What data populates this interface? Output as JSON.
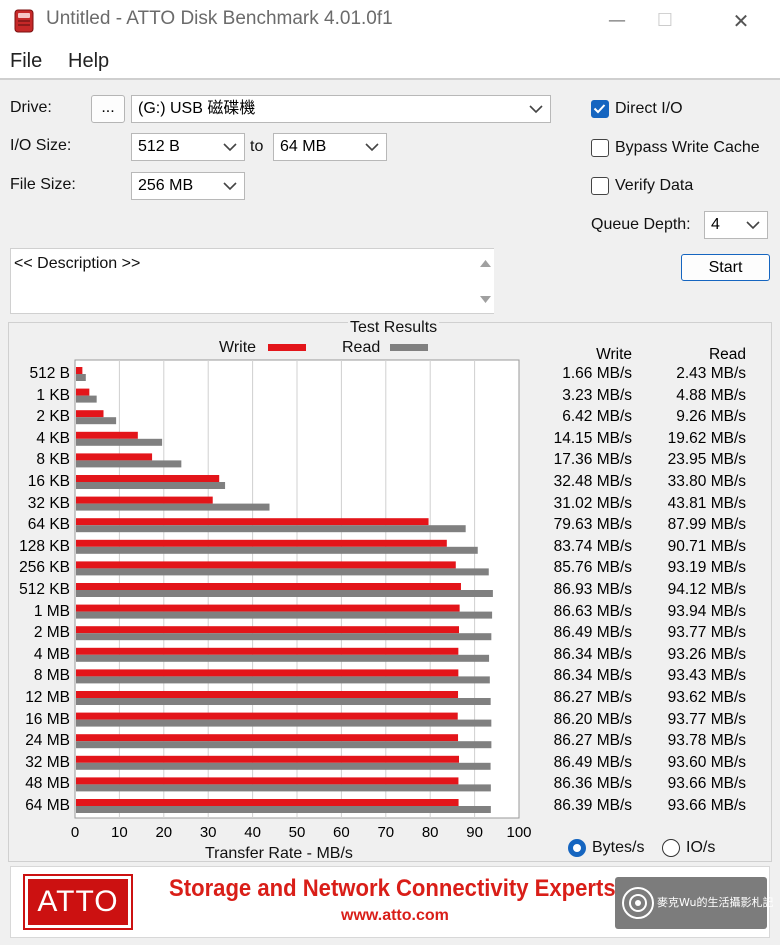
{
  "window": {
    "title": "Untitled - ATTO Disk Benchmark 4.01.0f1",
    "min": "—",
    "max": "☐",
    "close": "✕"
  },
  "menu": [
    "File",
    "Help"
  ],
  "form": {
    "drive_label": "Drive:",
    "browse_label": "...",
    "drive_value": "(G:) USB 磁碟機",
    "io_label": "I/O Size:",
    "io_from": "512 B",
    "io_to_label": "to",
    "io_to": "64 MB",
    "file_label": "File Size:",
    "file_value": "256 MB",
    "direct_io": {
      "label": "Direct I/O",
      "checked": true
    },
    "bypass": {
      "label": "Bypass Write Cache",
      "checked": false
    },
    "verify": {
      "label": "Verify Data",
      "checked": false
    },
    "queue_label": "Queue Depth:",
    "queue_value": "4",
    "start_label": "Start",
    "description": "<< Description >>"
  },
  "results": {
    "title": "Test Results",
    "legend_write": "Write",
    "legend_read": "Read",
    "col_write": "Write",
    "col_read": "Read",
    "xlabel": "Transfer Rate - MB/s",
    "unit_bytes": "Bytes/s",
    "unit_io": "IO/s",
    "unit_selected": "Bytes/s"
  },
  "chart_data": {
    "type": "bar",
    "orientation": "horizontal",
    "xlim": [
      0,
      100
    ],
    "xticks": [
      0,
      10,
      20,
      30,
      40,
      50,
      60,
      70,
      80,
      90,
      100
    ],
    "write_color": "#e3151a",
    "read_color": "#808080",
    "categories": [
      "512 B",
      "1 KB",
      "2 KB",
      "4 KB",
      "8 KB",
      "16 KB",
      "32 KB",
      "64 KB",
      "128 KB",
      "256 KB",
      "512 KB",
      "1 MB",
      "2 MB",
      "4 MB",
      "8 MB",
      "12 MB",
      "16 MB",
      "24 MB",
      "32 MB",
      "48 MB",
      "64 MB"
    ],
    "series": [
      {
        "name": "Write",
        "values": [
          1.66,
          3.23,
          6.42,
          14.15,
          17.36,
          32.48,
          31.02,
          79.63,
          83.74,
          85.76,
          86.93,
          86.63,
          86.49,
          86.34,
          86.34,
          86.27,
          86.2,
          86.27,
          86.49,
          86.36,
          86.39
        ],
        "labels": [
          "1.66 MB/s",
          "3.23 MB/s",
          "6.42 MB/s",
          "14.15 MB/s",
          "17.36 MB/s",
          "32.48 MB/s",
          "31.02 MB/s",
          "79.63 MB/s",
          "83.74 MB/s",
          "85.76 MB/s",
          "86.93 MB/s",
          "86.63 MB/s",
          "86.49 MB/s",
          "86.34 MB/s",
          "86.34 MB/s",
          "86.27 MB/s",
          "86.20 MB/s",
          "86.27 MB/s",
          "86.49 MB/s",
          "86.36 MB/s",
          "86.39 MB/s"
        ]
      },
      {
        "name": "Read",
        "values": [
          2.43,
          4.88,
          9.26,
          19.62,
          23.95,
          33.8,
          43.81,
          87.99,
          90.71,
          93.19,
          94.12,
          93.94,
          93.77,
          93.26,
          93.43,
          93.62,
          93.77,
          93.78,
          93.6,
          93.66,
          93.66
        ],
        "labels": [
          "2.43 MB/s",
          "4.88 MB/s",
          "9.26 MB/s",
          "19.62 MB/s",
          "23.95 MB/s",
          "33.80 MB/s",
          "43.81 MB/s",
          "87.99 MB/s",
          "90.71 MB/s",
          "93.19 MB/s",
          "94.12 MB/s",
          "93.94 MB/s",
          "93.77 MB/s",
          "93.26 MB/s",
          "93.43 MB/s",
          "93.62 MB/s",
          "93.77 MB/s",
          "93.78 MB/s",
          "93.60 MB/s",
          "93.66 MB/s",
          "93.66 MB/s"
        ]
      }
    ]
  },
  "banner": {
    "logo": "ATTO",
    "tagline": "Storage and Network Connectivity Experts",
    "url": "www.atto.com",
    "watermark": "麥克Wu的生活攝影札記"
  },
  "colors": {
    "accent": "#1565c0",
    "brand_red": "#e3151a",
    "bar_read": "#808080"
  }
}
